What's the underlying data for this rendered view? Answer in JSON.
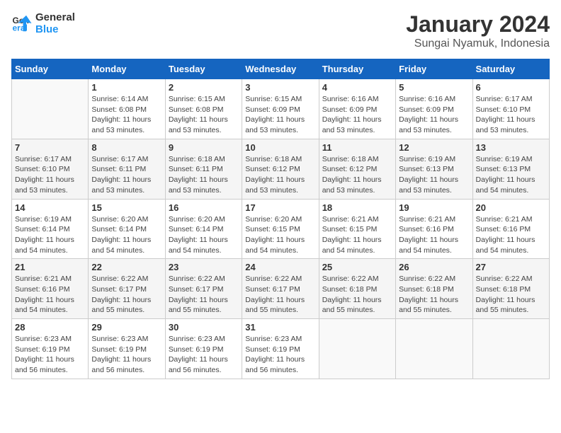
{
  "header": {
    "logo_line1": "General",
    "logo_line2": "Blue",
    "title": "January 2024",
    "subtitle": "Sungai Nyamuk, Indonesia"
  },
  "days_of_week": [
    "Sunday",
    "Monday",
    "Tuesday",
    "Wednesday",
    "Thursday",
    "Friday",
    "Saturday"
  ],
  "weeks": [
    [
      {
        "day": "",
        "info": ""
      },
      {
        "day": "1",
        "info": "Sunrise: 6:14 AM\nSunset: 6:08 PM\nDaylight: 11 hours\nand 53 minutes."
      },
      {
        "day": "2",
        "info": "Sunrise: 6:15 AM\nSunset: 6:08 PM\nDaylight: 11 hours\nand 53 minutes."
      },
      {
        "day": "3",
        "info": "Sunrise: 6:15 AM\nSunset: 6:09 PM\nDaylight: 11 hours\nand 53 minutes."
      },
      {
        "day": "4",
        "info": "Sunrise: 6:16 AM\nSunset: 6:09 PM\nDaylight: 11 hours\nand 53 minutes."
      },
      {
        "day": "5",
        "info": "Sunrise: 6:16 AM\nSunset: 6:09 PM\nDaylight: 11 hours\nand 53 minutes."
      },
      {
        "day": "6",
        "info": "Sunrise: 6:17 AM\nSunset: 6:10 PM\nDaylight: 11 hours\nand 53 minutes."
      }
    ],
    [
      {
        "day": "7",
        "info": "Sunrise: 6:17 AM\nSunset: 6:10 PM\nDaylight: 11 hours\nand 53 minutes."
      },
      {
        "day": "8",
        "info": "Sunrise: 6:17 AM\nSunset: 6:11 PM\nDaylight: 11 hours\nand 53 minutes."
      },
      {
        "day": "9",
        "info": "Sunrise: 6:18 AM\nSunset: 6:11 PM\nDaylight: 11 hours\nand 53 minutes."
      },
      {
        "day": "10",
        "info": "Sunrise: 6:18 AM\nSunset: 6:12 PM\nDaylight: 11 hours\nand 53 minutes."
      },
      {
        "day": "11",
        "info": "Sunrise: 6:18 AM\nSunset: 6:12 PM\nDaylight: 11 hours\nand 53 minutes."
      },
      {
        "day": "12",
        "info": "Sunrise: 6:19 AM\nSunset: 6:13 PM\nDaylight: 11 hours\nand 53 minutes."
      },
      {
        "day": "13",
        "info": "Sunrise: 6:19 AM\nSunset: 6:13 PM\nDaylight: 11 hours\nand 54 minutes."
      }
    ],
    [
      {
        "day": "14",
        "info": "Sunrise: 6:19 AM\nSunset: 6:14 PM\nDaylight: 11 hours\nand 54 minutes."
      },
      {
        "day": "15",
        "info": "Sunrise: 6:20 AM\nSunset: 6:14 PM\nDaylight: 11 hours\nand 54 minutes."
      },
      {
        "day": "16",
        "info": "Sunrise: 6:20 AM\nSunset: 6:14 PM\nDaylight: 11 hours\nand 54 minutes."
      },
      {
        "day": "17",
        "info": "Sunrise: 6:20 AM\nSunset: 6:15 PM\nDaylight: 11 hours\nand 54 minutes."
      },
      {
        "day": "18",
        "info": "Sunrise: 6:21 AM\nSunset: 6:15 PM\nDaylight: 11 hours\nand 54 minutes."
      },
      {
        "day": "19",
        "info": "Sunrise: 6:21 AM\nSunset: 6:16 PM\nDaylight: 11 hours\nand 54 minutes."
      },
      {
        "day": "20",
        "info": "Sunrise: 6:21 AM\nSunset: 6:16 PM\nDaylight: 11 hours\nand 54 minutes."
      }
    ],
    [
      {
        "day": "21",
        "info": "Sunrise: 6:21 AM\nSunset: 6:16 PM\nDaylight: 11 hours\nand 54 minutes."
      },
      {
        "day": "22",
        "info": "Sunrise: 6:22 AM\nSunset: 6:17 PM\nDaylight: 11 hours\nand 55 minutes."
      },
      {
        "day": "23",
        "info": "Sunrise: 6:22 AM\nSunset: 6:17 PM\nDaylight: 11 hours\nand 55 minutes."
      },
      {
        "day": "24",
        "info": "Sunrise: 6:22 AM\nSunset: 6:17 PM\nDaylight: 11 hours\nand 55 minutes."
      },
      {
        "day": "25",
        "info": "Sunrise: 6:22 AM\nSunset: 6:18 PM\nDaylight: 11 hours\nand 55 minutes."
      },
      {
        "day": "26",
        "info": "Sunrise: 6:22 AM\nSunset: 6:18 PM\nDaylight: 11 hours\nand 55 minutes."
      },
      {
        "day": "27",
        "info": "Sunrise: 6:22 AM\nSunset: 6:18 PM\nDaylight: 11 hours\nand 55 minutes."
      }
    ],
    [
      {
        "day": "28",
        "info": "Sunrise: 6:23 AM\nSunset: 6:19 PM\nDaylight: 11 hours\nand 56 minutes."
      },
      {
        "day": "29",
        "info": "Sunrise: 6:23 AM\nSunset: 6:19 PM\nDaylight: 11 hours\nand 56 minutes."
      },
      {
        "day": "30",
        "info": "Sunrise: 6:23 AM\nSunset: 6:19 PM\nDaylight: 11 hours\nand 56 minutes."
      },
      {
        "day": "31",
        "info": "Sunrise: 6:23 AM\nSunset: 6:19 PM\nDaylight: 11 hours\nand 56 minutes."
      },
      {
        "day": "",
        "info": ""
      },
      {
        "day": "",
        "info": ""
      },
      {
        "day": "",
        "info": ""
      }
    ]
  ]
}
